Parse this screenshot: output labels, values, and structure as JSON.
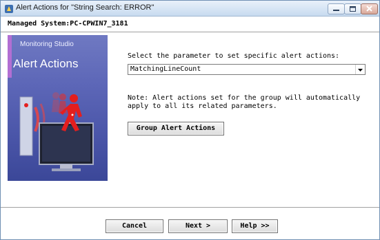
{
  "window": {
    "title": "Alert Actions for \"String Search: ERROR\""
  },
  "header": {
    "managed_system": "Managed System:PC-CPWIN7_3181"
  },
  "banner": {
    "brand": "Monitoring Studio",
    "title": "Alert Actions"
  },
  "form": {
    "prompt": "Select the parameter to set specific alert actions:",
    "parameter_selected": "MatchingLineCount",
    "note": "Note: Alert actions set for the group will automatically apply to all its related parameters.",
    "group_button_label": "Group Alert Actions"
  },
  "footer": {
    "cancel_label": "Cancel",
    "next_label": "Next >",
    "help_label": "Help >>"
  },
  "icons": {
    "app": "app-icon",
    "minimize": "minimize-icon",
    "maximize": "maximize-icon",
    "close": "close-icon",
    "dropdown": "chevron-down-icon"
  },
  "colors": {
    "banner_top": "#6f79c2",
    "banner_bottom": "#3b4798",
    "banner_accent": "#b26fd3",
    "alert_figure": "#e41e1e"
  }
}
